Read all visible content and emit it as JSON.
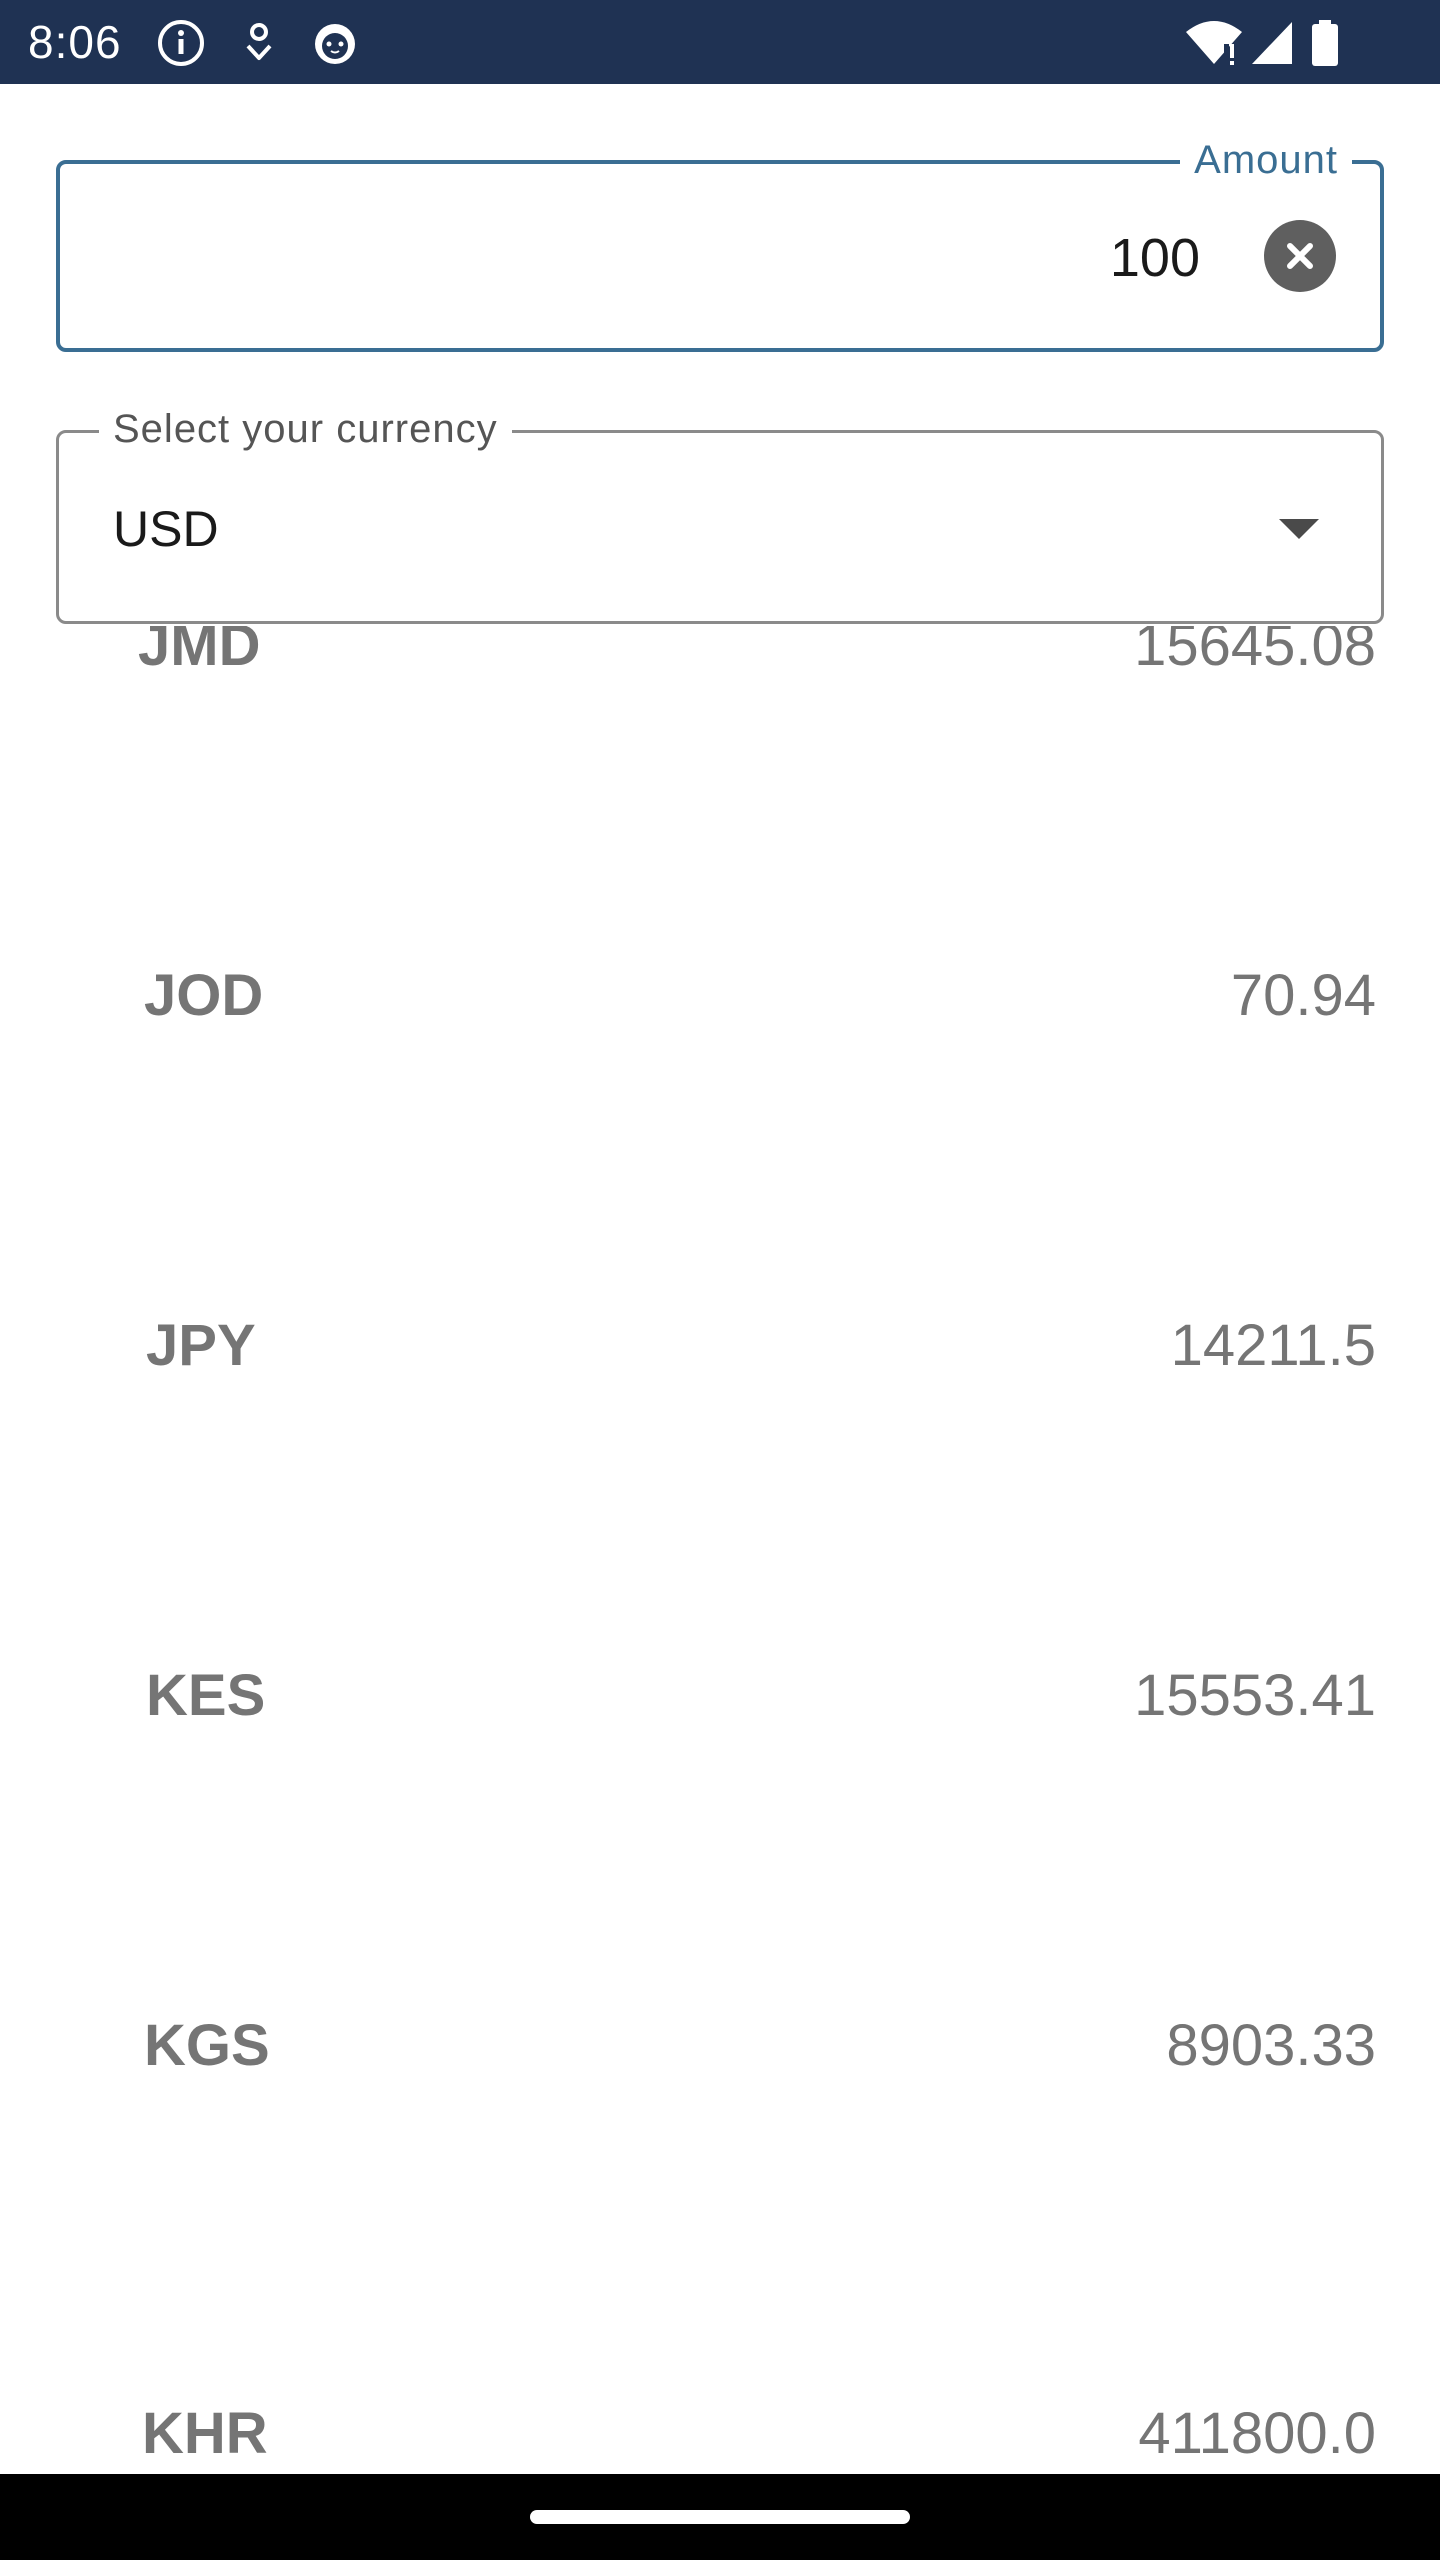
{
  "status_bar": {
    "time": "8:06",
    "left_icons": [
      "info-icon",
      "pin-icon",
      "cat-face-icon"
    ],
    "right_icons": [
      "wifi-icon",
      "signal-icon",
      "battery-icon"
    ]
  },
  "amount": {
    "label": "Amount",
    "value": "100",
    "accent_color": "#3a6e93"
  },
  "currency_select": {
    "label": "Select your currency",
    "selected": "USD"
  },
  "rates": [
    {
      "code": "JMD",
      "value": "15645.08"
    },
    {
      "code": "JOD",
      "value": "70.94"
    },
    {
      "code": "JPY",
      "value": "14211.5"
    },
    {
      "code": "KES",
      "value": "15553.41"
    },
    {
      "code": "KGS",
      "value": "8903.33"
    },
    {
      "code": "KHR",
      "value": "411800.0"
    }
  ],
  "colors": {
    "status_bar": "#1f3253",
    "nav_bar": "#000000",
    "text_muted": "#757575"
  }
}
